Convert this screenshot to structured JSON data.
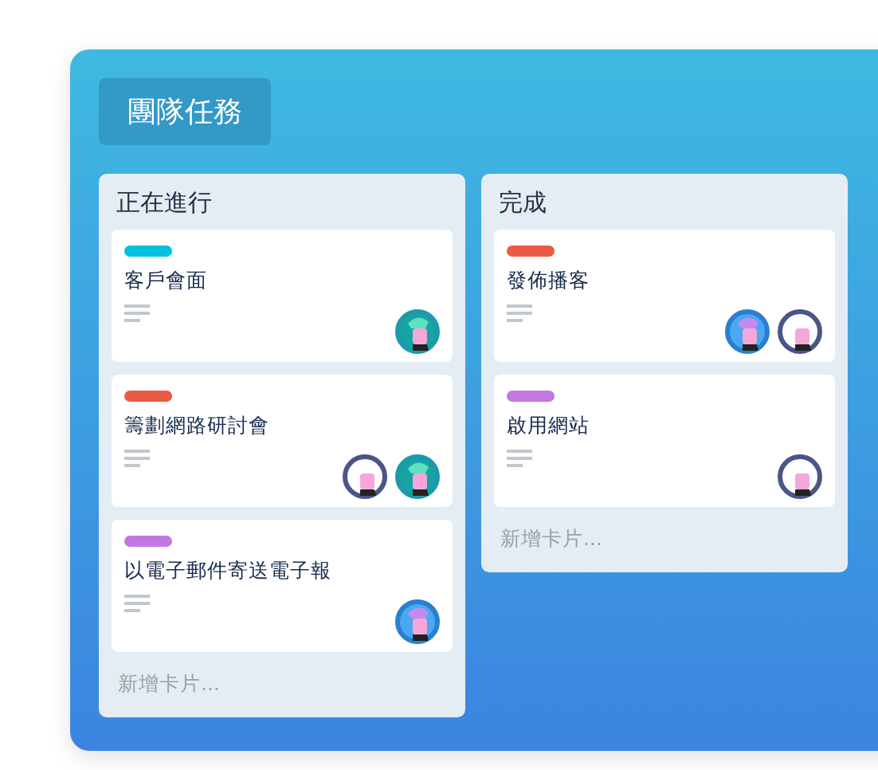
{
  "board": {
    "title": "團隊任務"
  },
  "lists": [
    {
      "title": "正在進行",
      "cards": [
        {
          "color": "#00c2e0",
          "title": "客戶會面",
          "has_description": true,
          "members": [
            {
              "kind": "mint"
            }
          ]
        },
        {
          "color": "#eb5a46",
          "title": "籌劃網路研討會",
          "has_description": true,
          "members": [
            {
              "kind": "outline"
            },
            {
              "kind": "mint"
            }
          ]
        },
        {
          "color": "#c377e0",
          "title": "以電子郵件寄送電子報",
          "has_description": true,
          "members": [
            {
              "kind": "violet"
            }
          ]
        }
      ],
      "add_card": "新增卡片..."
    },
    {
      "title": "完成",
      "cards": [
        {
          "color": "#eb5a46",
          "title": "發佈播客",
          "has_description": true,
          "members": [
            {
              "kind": "violet"
            },
            {
              "kind": "outline"
            }
          ]
        },
        {
          "color": "#c377e0",
          "title": "啟用網站",
          "has_description": true,
          "members": [
            {
              "kind": "outline"
            }
          ]
        }
      ],
      "add_card": "新增卡片..."
    }
  ]
}
